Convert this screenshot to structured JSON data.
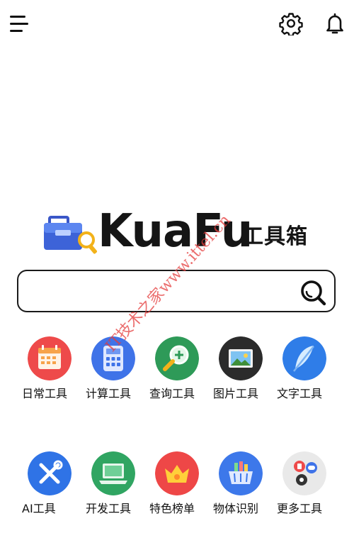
{
  "brand": {
    "name": "KuaFu",
    "suffix": "工具箱"
  },
  "search": {
    "value": "",
    "placeholder": ""
  },
  "icons": {
    "menu": "menu-icon",
    "settings": "gear-icon",
    "notifications": "bell-icon",
    "search": "search-icon"
  },
  "tools": [
    {
      "label": "日常工具",
      "icon": "calendar-icon",
      "color": "#ee4a4a"
    },
    {
      "label": "计算工具",
      "icon": "calculator-icon",
      "color": "#3f73e8"
    },
    {
      "label": "查询工具",
      "icon": "magnifier-plus-icon",
      "color": "#2e9a58"
    },
    {
      "label": "图片工具",
      "icon": "picture-icon",
      "color": "#2b2b2b"
    },
    {
      "label": "文字工具",
      "icon": "feather-icon",
      "color": "#2f7de8"
    },
    {
      "label": "AI工具",
      "icon": "wrench-screwdriver-icon",
      "color": "#2f73e6"
    },
    {
      "label": "开发工具",
      "icon": "laptop-icon",
      "color": "#30a562"
    },
    {
      "label": "特色榜单",
      "icon": "crown-icon",
      "color": "#ee4747"
    },
    {
      "label": "物体识别",
      "icon": "basket-icon",
      "color": "#3d78ea"
    },
    {
      "label": "更多工具",
      "icon": "apps-icon",
      "color": "#e9e9e9"
    }
  ],
  "watermark": "IT技术之家www.ittel.cn"
}
